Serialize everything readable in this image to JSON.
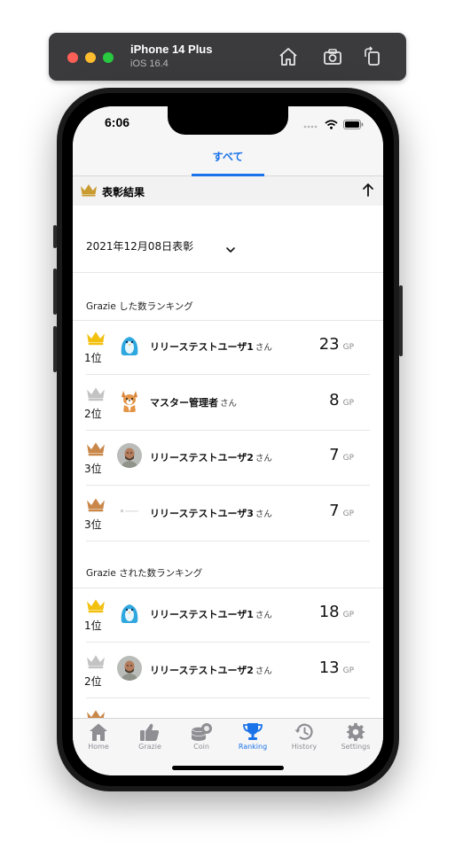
{
  "simulator": {
    "device": "iPhone 14 Plus",
    "os": "iOS 16.4",
    "icons": [
      "home-icon",
      "screenshot-icon",
      "rotate-icon"
    ]
  },
  "status_bar": {
    "time": "6:06"
  },
  "tabs": {
    "active": "すべて"
  },
  "awards": {
    "title": "表彰結果",
    "date": "2021年12月08日表彰"
  },
  "rankings": [
    {
      "label": "Grazie した数ランキング",
      "unit": "GP",
      "entries": [
        {
          "position": "1位",
          "name": "リリーステストユーザ1",
          "suffix": "さん",
          "score": "23",
          "crown": "gold",
          "avatar": "penguin"
        },
        {
          "position": "2位",
          "name": "マスター管理者",
          "suffix": "さん",
          "score": "8",
          "crown": "silver",
          "avatar": "dog"
        },
        {
          "position": "3位",
          "name": "リリーステストユーザ2",
          "suffix": "さん",
          "score": "7",
          "crown": "bronze",
          "avatar": "man"
        },
        {
          "position": "3位",
          "name": "リリーステストユーザ3",
          "suffix": "さん",
          "score": "7",
          "crown": "bronze",
          "avatar": "logo"
        }
      ]
    },
    {
      "label": "Grazie された数ランキング",
      "unit": "GP",
      "entries": [
        {
          "position": "1位",
          "name": "リリーステストユーザ1",
          "suffix": "さん",
          "score": "18",
          "crown": "gold",
          "avatar": "penguin"
        },
        {
          "position": "2位",
          "name": "リリーステストユーザ2",
          "suffix": "さん",
          "score": "13",
          "crown": "silver",
          "avatar": "man"
        }
      ]
    }
  ],
  "tab_bar": [
    {
      "label": "Home",
      "icon": "home-icon"
    },
    {
      "label": "Grazie",
      "icon": "thumbs-up-icon"
    },
    {
      "label": "Coin",
      "icon": "coins-icon"
    },
    {
      "label": "Ranking",
      "icon": "trophy-icon",
      "active": true
    },
    {
      "label": "History",
      "icon": "history-icon"
    },
    {
      "label": "Settings",
      "icon": "gear-icon"
    }
  ],
  "colors": {
    "accent": "#1a73e8",
    "gold": "#f2c00f",
    "silver": "#c3c3c3",
    "bronze": "#c9874a",
    "header_crown": "#c99a2e"
  }
}
